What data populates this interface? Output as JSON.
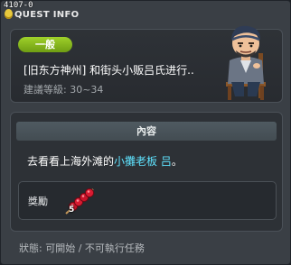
{
  "window": {
    "quest_id": "4107-0",
    "title": "QUEST INFO"
  },
  "header": {
    "tag": "一般",
    "quest_name": "[旧东方神州] 和街头小贩吕氏进行..",
    "level": "建議等級: 30~34"
  },
  "content": {
    "section_title": "內容",
    "description_prefix": "去看看上海外滩的",
    "description_highlight": "小攤老板 吕",
    "description_suffix": "。"
  },
  "reward": {
    "label": "獎勵",
    "item_icon": "candied-fruit-skewer-icon",
    "item_count": "5"
  },
  "status": "狀態: 可開始 / 不可執行任務",
  "colors": {
    "tag_green": "#8ec21f",
    "highlight_cyan": "#5fe3ff",
    "panel_bg": "#2d3136"
  }
}
